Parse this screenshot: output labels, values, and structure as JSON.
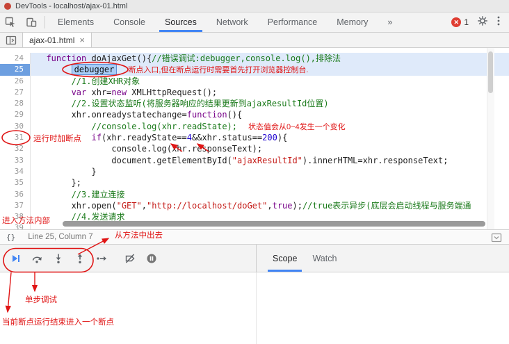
{
  "window": {
    "title": "DevTools - localhost/ajax-01.html"
  },
  "toolbar": {
    "tabs": [
      "Elements",
      "Console",
      "Sources",
      "Network",
      "Performance",
      "Memory",
      "»"
    ],
    "selected_tab": "Sources",
    "error_icon": "✕",
    "error_count": "1"
  },
  "file_tabs": {
    "active": "ajax-01.html",
    "close_label": "×"
  },
  "status_bar": {
    "pretty_print_label": "{}",
    "cursor_position": "Line 25, Column 7"
  },
  "debug": {
    "tabs": [
      "Scope",
      "Watch"
    ],
    "selected_tab": "Scope"
  },
  "colors": {
    "accent": "#4285f4",
    "annotation_red": "#e01515",
    "error_red": "#df3d32"
  },
  "code": {
    "lines": [
      {
        "no": 24,
        "indent": 2,
        "hl": "rowhl",
        "segments": [
          {
            "t": "function",
            "c": "kw"
          },
          {
            "t": " doAjaxGet(){",
            "c": "pl"
          },
          {
            "t": "//错误调试:debugger,console.log(),排除法",
            "c": "cm"
          }
        ]
      },
      {
        "no": 25,
        "indent": 7,
        "hl": "rowhl",
        "gut_hl": true,
        "segments": [
          {
            "t": "debugger",
            "c": "exec"
          },
          {
            "t": "断点入口,但在断点运行时需要首先打开浏览器控制台.",
            "c": "ann"
          }
        ]
      },
      {
        "no": 26,
        "indent": 7,
        "segments": [
          {
            "t": "//1.创建XHR对象",
            "c": "cm"
          }
        ]
      },
      {
        "no": 27,
        "indent": 7,
        "segments": [
          {
            "t": "var",
            "c": "kw"
          },
          {
            "t": " xhr=",
            "c": "pl"
          },
          {
            "t": "new",
            "c": "kw"
          },
          {
            "t": " XMLHttpRequest();",
            "c": "pl"
          }
        ]
      },
      {
        "no": 28,
        "indent": 7,
        "segments": [
          {
            "t": "//2.设置状态监听(将服务器响应的结果更新到ajaxResultId位置)",
            "c": "cm"
          }
        ]
      },
      {
        "no": 29,
        "indent": 7,
        "segments": [
          {
            "t": "xhr.onreadystatechange=",
            "c": "pl"
          },
          {
            "t": "function",
            "c": "kw"
          },
          {
            "t": "(){",
            "c": "pl"
          }
        ]
      },
      {
        "no": 30,
        "indent": 11,
        "segments": [
          {
            "t": "//console.log(xhr.readState);",
            "c": "cm"
          },
          {
            "t": "状态值会从0~4发生一个变化",
            "c": "ann"
          }
        ]
      },
      {
        "no": 31,
        "indent": 11,
        "segments": [
          {
            "t": "if",
            "c": "kw"
          },
          {
            "t": "(xhr.readyState==",
            "c": "pl"
          },
          {
            "t": "4",
            "c": "num"
          },
          {
            "t": "&&xhr.status==",
            "c": "pl"
          },
          {
            "t": "200",
            "c": "num"
          },
          {
            "t": "){",
            "c": "pl"
          }
        ]
      },
      {
        "no": 32,
        "indent": 15,
        "segments": [
          {
            "t": "console.log(xhr.responseText);",
            "c": "pl"
          }
        ]
      },
      {
        "no": 33,
        "indent": 15,
        "segments": [
          {
            "t": "document.getElementById(",
            "c": "pl"
          },
          {
            "t": "\"ajaxResultId\"",
            "c": "str"
          },
          {
            "t": ").innerHTML=xhr.responseText;",
            "c": "pl"
          }
        ]
      },
      {
        "no": 34,
        "indent": 11,
        "segments": [
          {
            "t": "}",
            "c": "pl"
          }
        ]
      },
      {
        "no": 35,
        "indent": 7,
        "segments": [
          {
            "t": "};",
            "c": "pl"
          }
        ]
      },
      {
        "no": 36,
        "indent": 7,
        "segments": [
          {
            "t": "//3.建立连接",
            "c": "cm"
          }
        ]
      },
      {
        "no": 37,
        "indent": 7,
        "segments": [
          {
            "t": "xhr.open(",
            "c": "pl"
          },
          {
            "t": "\"GET\"",
            "c": "str"
          },
          {
            "t": ",",
            "c": "pl"
          },
          {
            "t": "\"http://localhost/doGet\"",
            "c": "str"
          },
          {
            "t": ",",
            "c": "pl"
          },
          {
            "t": "true",
            "c": "kw"
          },
          {
            "t": ");",
            "c": "pl"
          },
          {
            "t": "//true表示异步(底层会启动线程与服务端通",
            "c": "cm"
          }
        ]
      },
      {
        "no": 38,
        "indent": 7,
        "segments": [
          {
            "t": "//4.发送请求",
            "c": "cm"
          }
        ]
      },
      {
        "no": 39,
        "indent": 0,
        "segments": []
      }
    ]
  },
  "annotations": {
    "runtime_breakpoint": "运行时加断点",
    "enter_method": "进入方法内部",
    "exit_method": "从方法中出去",
    "single_step": "单步调试",
    "breakpoint_done": "当前断点运行结束进入一个断点"
  }
}
